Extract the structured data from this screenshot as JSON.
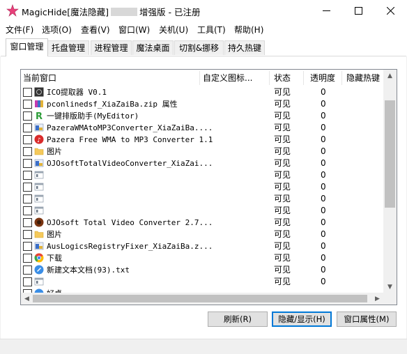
{
  "window": {
    "title_prefix": "MagicHide[魔法隐藏]",
    "title_suffix": "增强版 - 已注册",
    "minimize_label": "—",
    "maximize_label": "☐",
    "close_label": "✕"
  },
  "menu": [
    "文件(F)",
    "选项(O)",
    "查看(V)",
    "窗口(W)",
    "关机(U)",
    "工具(T)",
    "帮助(H)"
  ],
  "tabs": [
    "窗口管理",
    "托盘管理",
    "进程管理",
    "魔法桌面",
    "切割&挪移",
    "持久热键"
  ],
  "active_tab": "窗口管理",
  "columns": [
    "当前窗口",
    "自定义图标...",
    "状态",
    "透明度",
    "隐藏热键"
  ],
  "rows": [
    {
      "name": "ICO提取器 V0.1",
      "status": "可见",
      "transparency": "0",
      "icon": "ico-extractor-icon",
      "color": "#333333"
    },
    {
      "name": "pconlinedsf_XiaZaiBa.zip 属性",
      "status": "可见",
      "transparency": "0",
      "icon": "winrar-icon",
      "color": "#3b6fc9"
    },
    {
      "name": "一键排版助手(MyEditor)",
      "status": "可见",
      "transparency": "0",
      "icon": "r-letter-icon",
      "color": "#2e9d3a"
    },
    {
      "name": "PazeraWMAtoMP3Converter_XiaZaiBa....",
      "status": "可见",
      "transparency": "0",
      "icon": "installer-icon",
      "color": "#3b6fc9"
    },
    {
      "name": "Pazera Free WMA to MP3 Converter 1.1",
      "status": "可见",
      "transparency": "0",
      "icon": "pazera-icon",
      "color": "#d92b2b"
    },
    {
      "name": "图片",
      "status": "可见",
      "transparency": "0",
      "icon": "folder-icon",
      "color": "#f5c95b"
    },
    {
      "name": "OJOsoftTotalVideoConverter_XiaZai...",
      "status": "可见",
      "transparency": "0",
      "icon": "installer-icon",
      "color": "#3b6fc9"
    },
    {
      "name": "",
      "status": "可见",
      "transparency": "0",
      "icon": "blank-window-icon",
      "color": "#9aa5b1"
    },
    {
      "name": "",
      "status": "可见",
      "transparency": "0",
      "icon": "blank-window-icon",
      "color": "#9aa5b1"
    },
    {
      "name": "",
      "status": "可见",
      "transparency": "0",
      "icon": "blank-window-icon",
      "color": "#9aa5b1"
    },
    {
      "name": "",
      "status": "可见",
      "transparency": "0",
      "icon": "blank-window-icon",
      "color": "#9aa5b1"
    },
    {
      "name": "OJOsoft Total Video Converter 2.7...",
      "status": "可见",
      "transparency": "0",
      "icon": "ojosoft-icon",
      "color": "#7a3410"
    },
    {
      "name": "图片",
      "status": "可见",
      "transparency": "0",
      "icon": "folder-icon",
      "color": "#f5c95b"
    },
    {
      "name": "AusLogicsRegistryFixer_XiaZaiBa.z...",
      "status": "可见",
      "transparency": "0",
      "icon": "installer-icon",
      "color": "#3b6fc9"
    },
    {
      "name": "下载",
      "status": "可见",
      "transparency": "0",
      "icon": "chrome-icon",
      "color": "#e94235"
    },
    {
      "name": "新建文本文档(93).txt",
      "status": "可见",
      "transparency": "0",
      "icon": "notepad-icon",
      "color": "#3a8ee6"
    },
    {
      "name": "",
      "status": "可见",
      "transparency": "0",
      "icon": "blank-window-icon",
      "color": "#9aa5b1"
    },
    {
      "name": "好桌",
      "status": "",
      "transparency": "",
      "icon": "app-icon",
      "color": "#3a8ee6"
    }
  ],
  "buttons": {
    "refresh": "刷新(R)",
    "hide_show": "隐藏/显示(H)",
    "properties": "窗口属性(M)"
  },
  "colors": {
    "accent": "#0078d7",
    "brand_star": "#e8407a"
  }
}
